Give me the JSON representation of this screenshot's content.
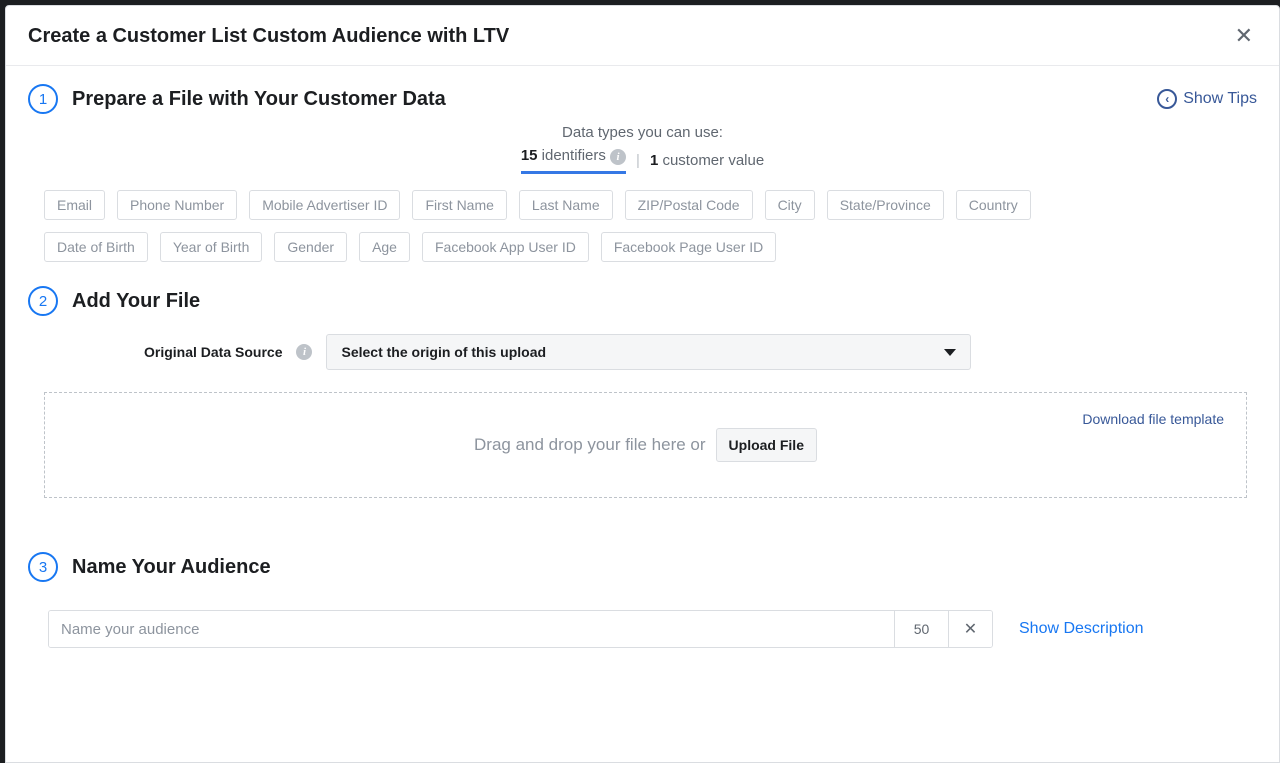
{
  "modal": {
    "title": "Create a Customer List Custom Audience with LTV",
    "show_tips": "Show Tips"
  },
  "step1": {
    "number": "1",
    "title": "Prepare a File with Your Customer Data",
    "datatypes_label": "Data types you can use:",
    "ident_count": "15",
    "ident_label": " identifiers ",
    "cv_count": "1",
    "cv_label": " customer value",
    "chips": [
      "Email",
      "Phone Number",
      "Mobile Advertiser ID",
      "First Name",
      "Last Name",
      "ZIP/Postal Code",
      "City",
      "State/Province",
      "Country",
      "Date of Birth",
      "Year of Birth",
      "Gender",
      "Age",
      "Facebook App User ID",
      "Facebook Page User ID"
    ]
  },
  "step2": {
    "number": "2",
    "title": "Add Your File",
    "source_label": "Original Data Source",
    "select_placeholder": "Select the origin of this upload",
    "drop_text": "Drag and drop your file here or",
    "upload_btn": "Upload File",
    "download_template": "Download file template"
  },
  "step3": {
    "number": "3",
    "title": "Name Your Audience",
    "placeholder": "Name your audience",
    "char_count": "50",
    "clear": "✕",
    "show_description": "Show Description"
  }
}
